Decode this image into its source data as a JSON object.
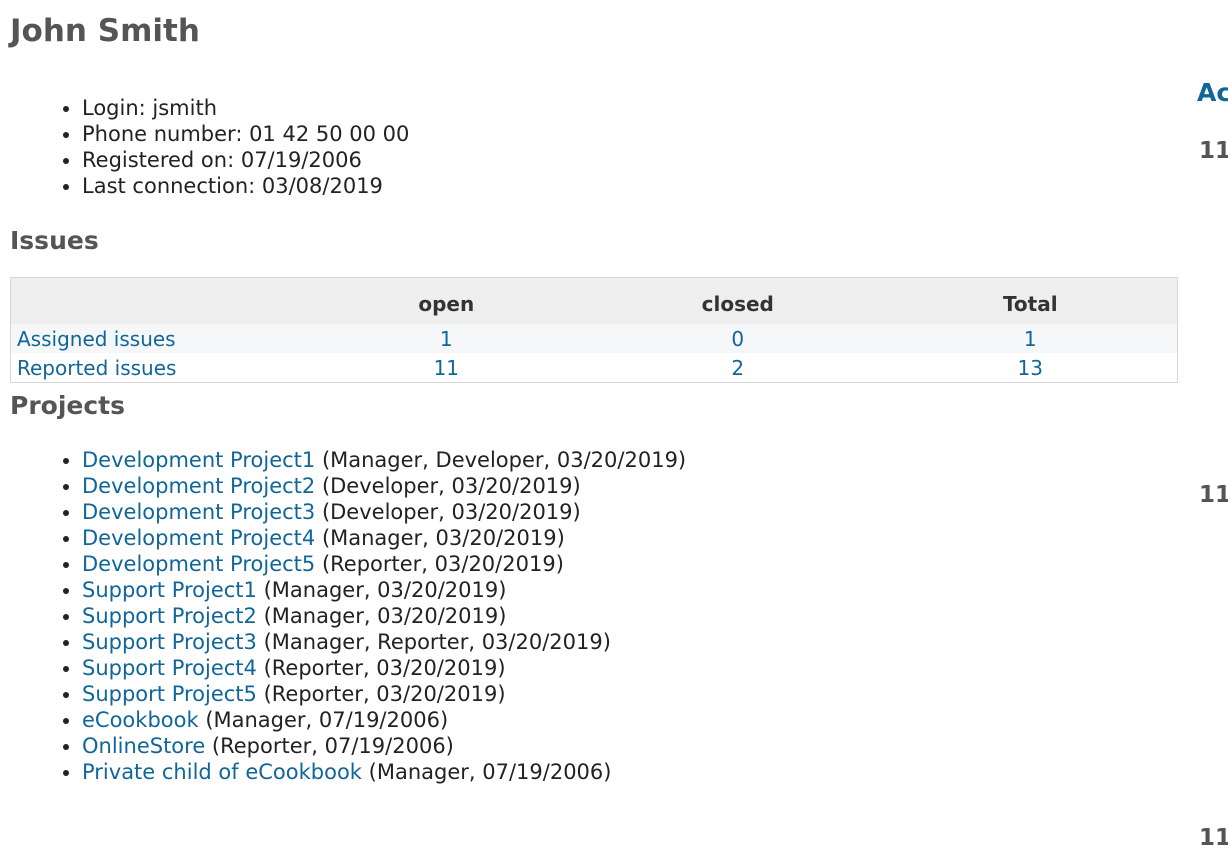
{
  "user": {
    "name": "John Smith",
    "info": [
      "Login: jsmith",
      "Phone number: 01 42 50 00 00",
      "Registered on: 07/19/2006",
      "Last connection: 03/08/2019"
    ]
  },
  "issues": {
    "title": "Issues",
    "headers": [
      "",
      "open",
      "closed",
      "Total"
    ],
    "rows": [
      {
        "label": "Assigned issues",
        "open": "1",
        "closed": "0",
        "total": "1"
      },
      {
        "label": "Reported issues",
        "open": "11",
        "closed": "2",
        "total": "13"
      }
    ]
  },
  "projects": {
    "title": "Projects",
    "items": [
      {
        "name": "Development Project1",
        "details": " (Manager, Developer, 03/20/2019)"
      },
      {
        "name": "Development Project2",
        "details": " (Developer, 03/20/2019)"
      },
      {
        "name": "Development Project3",
        "details": " (Developer, 03/20/2019)"
      },
      {
        "name": "Development Project4",
        "details": " (Manager, 03/20/2019)"
      },
      {
        "name": "Development Project5",
        "details": " (Reporter, 03/20/2019)"
      },
      {
        "name": "Support Project1",
        "details": " (Manager, 03/20/2019)"
      },
      {
        "name": "Support Project2",
        "details": " (Manager, 03/20/2019)"
      },
      {
        "name": "Support Project3",
        "details": " (Manager, Reporter, 03/20/2019)"
      },
      {
        "name": "Support Project4",
        "details": " (Reporter, 03/20/2019)"
      },
      {
        "name": "Support Project5",
        "details": " (Reporter, 03/20/2019)"
      },
      {
        "name": "eCookbook",
        "details": " (Manager, 07/19/2006)"
      },
      {
        "name": "OnlineStore",
        "details": " (Reporter, 07/19/2006)"
      },
      {
        "name": "Private child of eCookbook",
        "details": " (Manager, 07/19/2006)"
      }
    ]
  },
  "activity": {
    "title_visible": "Ac",
    "dates_visible": [
      "11",
      "11",
      "11"
    ]
  },
  "colors": {
    "link": "#116699",
    "heading": "#555555",
    "table_header_bg": "#eeeeee"
  }
}
